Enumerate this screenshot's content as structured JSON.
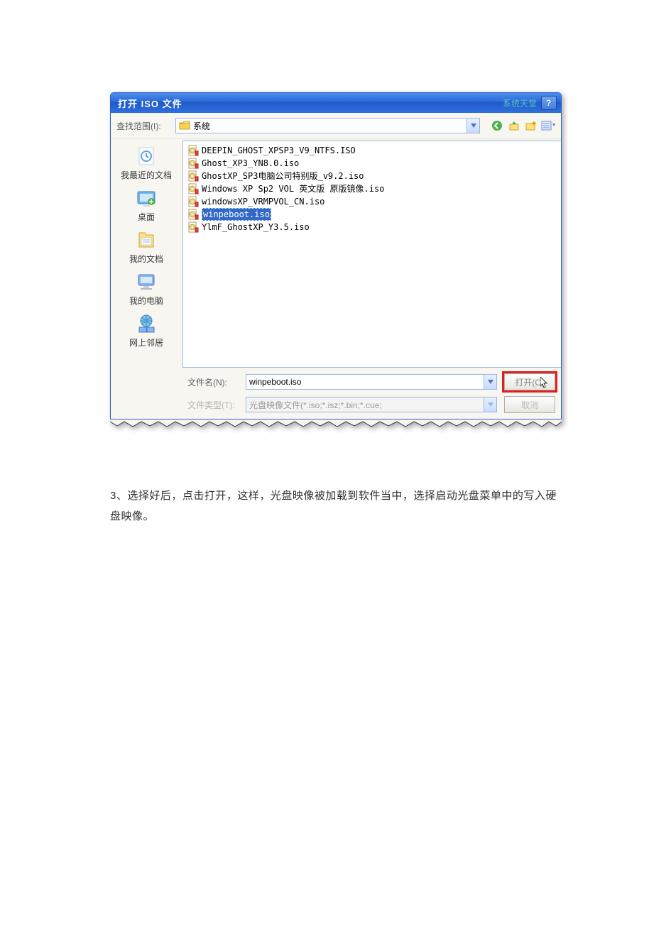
{
  "dialog": {
    "title": "打开 ISO 文件",
    "brand": "系统天堂",
    "help": "?",
    "lookin_label": "查找范围(I):",
    "lookin_value": "系统",
    "filename_label": "文件名(N):",
    "filename_value": "winpeboot.iso",
    "filetype_label": "文件类型(T):",
    "filetype_value": "光盘映像文件(*.iso;*.isz;*.bin;*.cue;",
    "open_btn": "打开(O)",
    "cancel_btn": "取消"
  },
  "places": [
    {
      "label": "我最近的文档",
      "icon": "recent-icon"
    },
    {
      "label": "桌面",
      "icon": "desktop-icon"
    },
    {
      "label": "我的文档",
      "icon": "mydocs-icon"
    },
    {
      "label": "我的电脑",
      "icon": "mycomputer-icon"
    },
    {
      "label": "网上邻居",
      "icon": "network-icon"
    }
  ],
  "files": [
    {
      "name": "DEEPIN_GHOST_XPSP3_V9_NTFS.ISO",
      "selected": false
    },
    {
      "name": "Ghost_XP3_YN8.0.iso",
      "selected": false
    },
    {
      "name": "GhostXP_SP3电脑公司特别版_v9.2.iso",
      "selected": false
    },
    {
      "name": "Windows XP Sp2 VOL 英文版 原版镜像.iso",
      "selected": false
    },
    {
      "name": "windowsXP_VRMPVOL_CN.iso",
      "selected": false
    },
    {
      "name": "winpeboot.iso",
      "selected": true
    },
    {
      "name": "YlmF_GhostXP_Y3.5.iso",
      "selected": false
    }
  ],
  "caption": "3、选择好后，点击打开，这样，光盘映像被加载到软件当中，选择启动光盘菜单中的写入硬盘映像。"
}
